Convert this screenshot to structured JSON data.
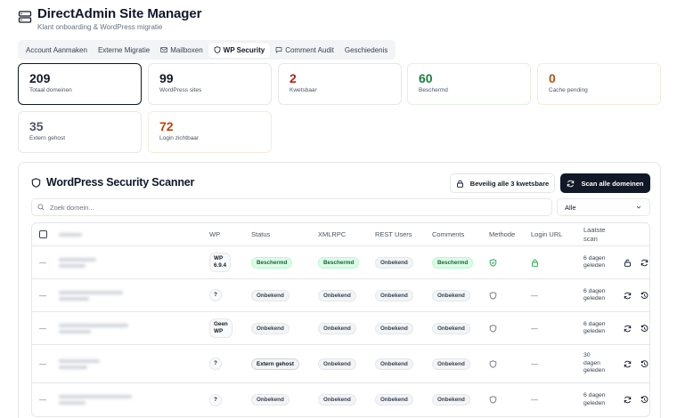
{
  "app": {
    "title": "DirectAdmin Site Manager",
    "subtitle": "Klant onboarding & WordPress migratie"
  },
  "tabs": [
    {
      "label": "Account Aanmaken"
    },
    {
      "label": "Externe Migratie"
    },
    {
      "label": "Mailboxen"
    },
    {
      "label": "WP Security"
    },
    {
      "label": "Comment Audit"
    },
    {
      "label": "Geschiedenis"
    }
  ],
  "stats": [
    {
      "value": "209",
      "label": "Totaal domeinen",
      "color": "#111827"
    },
    {
      "value": "99",
      "label": "WordPress sites",
      "color": "#111827"
    },
    {
      "value": "2",
      "label": "Kwetsbaar",
      "color": "#b91c1c"
    },
    {
      "value": "60",
      "label": "Beschermd",
      "color": "#15803d"
    },
    {
      "value": "0",
      "label": "Cache pending",
      "color": "#b45309"
    },
    {
      "value": "35",
      "label": "Extern gehost",
      "color": "#4b5563"
    },
    {
      "value": "72",
      "label": "Login zichtbaar",
      "color": "#c2410c"
    }
  ],
  "scanner": {
    "title": "WordPress Security Scanner",
    "secure_all_label": "Beveilig alle 3 kwetsbare",
    "scan_all_label": "Scan alle domeinen",
    "search_placeholder": "Zoek domein...",
    "filter_value": "Alle"
  },
  "table": {
    "headers": {
      "wp": "WP",
      "status": "Status",
      "xmlrpc": "XMLRPC",
      "rest_users": "REST Users",
      "comments": "Comments",
      "methode": "Methode",
      "login_url": "Login URL",
      "last_scan_1": "Laatste",
      "last_scan_2": "scan"
    },
    "rows": [
      {
        "dash": "—",
        "wp_1": "WP",
        "wp_2": "6.9.4",
        "status": "Beschermd",
        "xmlrpc": "Beschermd",
        "rest_users": "Onbekend",
        "comments": "Beschermd",
        "login": "",
        "scan_1": "6 dagen",
        "scan_2": "geleden",
        "scan_3": ""
      },
      {
        "dash": "—",
        "wp_1": "?",
        "wp_2": "",
        "status": "Onbekend",
        "xmlrpc": "Onbekend",
        "rest_users": "Onbekend",
        "comments": "Onbekend",
        "login": "—",
        "scan_1": "6 dagen",
        "scan_2": "geleden",
        "scan_3": ""
      },
      {
        "dash": "—",
        "wp_1": "Geen",
        "wp_2": "WP",
        "status": "Onbekend",
        "xmlrpc": "Onbekend",
        "rest_users": "Onbekend",
        "comments": "Onbekend",
        "login": "—",
        "scan_1": "6 dagen",
        "scan_2": "geleden",
        "scan_3": ""
      },
      {
        "dash": "—",
        "wp_1": "?",
        "wp_2": "",
        "status": "Extern gehost",
        "xmlrpc": "Onbekend",
        "rest_users": "Onbekend",
        "comments": "Onbekend",
        "login": "—",
        "scan_1": "30",
        "scan_2": "dagen",
        "scan_3": "geleden"
      },
      {
        "dash": "—",
        "wp_1": "?",
        "wp_2": "",
        "status": "Onbekend",
        "xmlrpc": "Onbekend",
        "rest_users": "Onbekend",
        "comments": "Onbekend",
        "login": "—",
        "scan_1": "6 dagen",
        "scan_2": "geleden",
        "scan_3": ""
      }
    ]
  },
  "colors": {
    "accent_dark": "#111827",
    "protected_green": "#16a34a",
    "vulnerable_red": "#b91c1c"
  },
  "icons": [
    "server-icon",
    "mail-icon",
    "shield-icon",
    "comment-icon",
    "lock-icon",
    "refresh-icon",
    "search-icon",
    "chevron-down-icon",
    "unlock-icon",
    "history-icon",
    "shield-check-icon"
  ]
}
